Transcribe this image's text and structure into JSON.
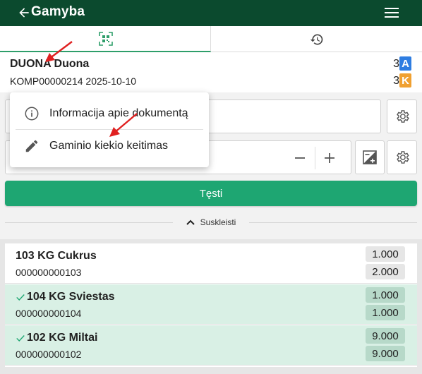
{
  "app": {
    "title": "Gamyba"
  },
  "tabs": [
    {
      "name": "scan-tab",
      "icon": "qr-scan-icon",
      "active": true
    },
    {
      "name": "history-tab",
      "icon": "history-icon",
      "active": false
    }
  ],
  "document": {
    "title": "DUONA Duona",
    "subtitle": "KOMP00000214 2025-10-10",
    "counts": [
      {
        "value": "3",
        "badge": "A",
        "color": "#2f7de1"
      },
      {
        "value": "3",
        "badge": "K",
        "color": "#f0a030"
      }
    ]
  },
  "popup_menu": {
    "items": [
      {
        "label": "Informacija apie dokumentą",
        "icon": "info-icon"
      },
      {
        "label": "Gaminio kiekio keitimas",
        "icon": "pencil-icon"
      }
    ]
  },
  "actions": {
    "continue_label": "Tęsti",
    "collapse_label": "Suskleisti"
  },
  "components": [
    {
      "title": "103 KG Cukrus",
      "code": "000000000103",
      "qty_required": "1.000",
      "qty_done": "2.000",
      "completed": false
    },
    {
      "title": "104 KG Sviestas",
      "code": "000000000104",
      "qty_required": "1.000",
      "qty_done": "1.000",
      "completed": true
    },
    {
      "title": "102 KG Miltai",
      "code": "000000000102",
      "qty_required": "9.000",
      "qty_done": "9.000",
      "completed": true
    }
  ],
  "colors": {
    "appbar": "#0b4a2e",
    "accent": "#1ea672",
    "completed_row": "#d9f0e5",
    "annotation_arrow": "#e02020"
  }
}
